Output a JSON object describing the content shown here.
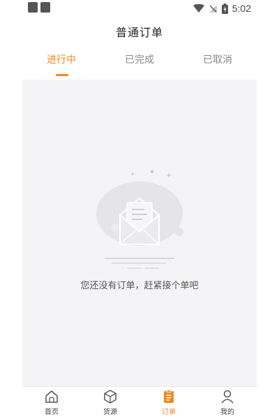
{
  "status_bar": {
    "time": "5:02",
    "icons": [
      "notification-square-icon",
      "notification-square-icon",
      "wifi-icon",
      "no-signal-icon",
      "battery-icon"
    ]
  },
  "header": {
    "title": "普通订单"
  },
  "tabs": [
    {
      "label": "进行中",
      "active": true
    },
    {
      "label": "已完成",
      "active": false
    },
    {
      "label": "已取消",
      "active": false
    }
  ],
  "empty_state": {
    "icon": "empty-mail-icon",
    "message": "您还没有订单，赶紧接个单吧"
  },
  "bottom_nav": [
    {
      "label": "首页",
      "icon": "home-icon",
      "active": false
    },
    {
      "label": "货源",
      "icon": "cube-icon",
      "active": false
    },
    {
      "label": "订单",
      "icon": "clipboard-icon",
      "active": true
    },
    {
      "label": "我的",
      "icon": "user-icon",
      "active": false
    }
  ],
  "colors": {
    "accent": "#f0881e",
    "background": "#f4f4f6",
    "text_primary": "#222222",
    "text_secondary": "#888888"
  }
}
